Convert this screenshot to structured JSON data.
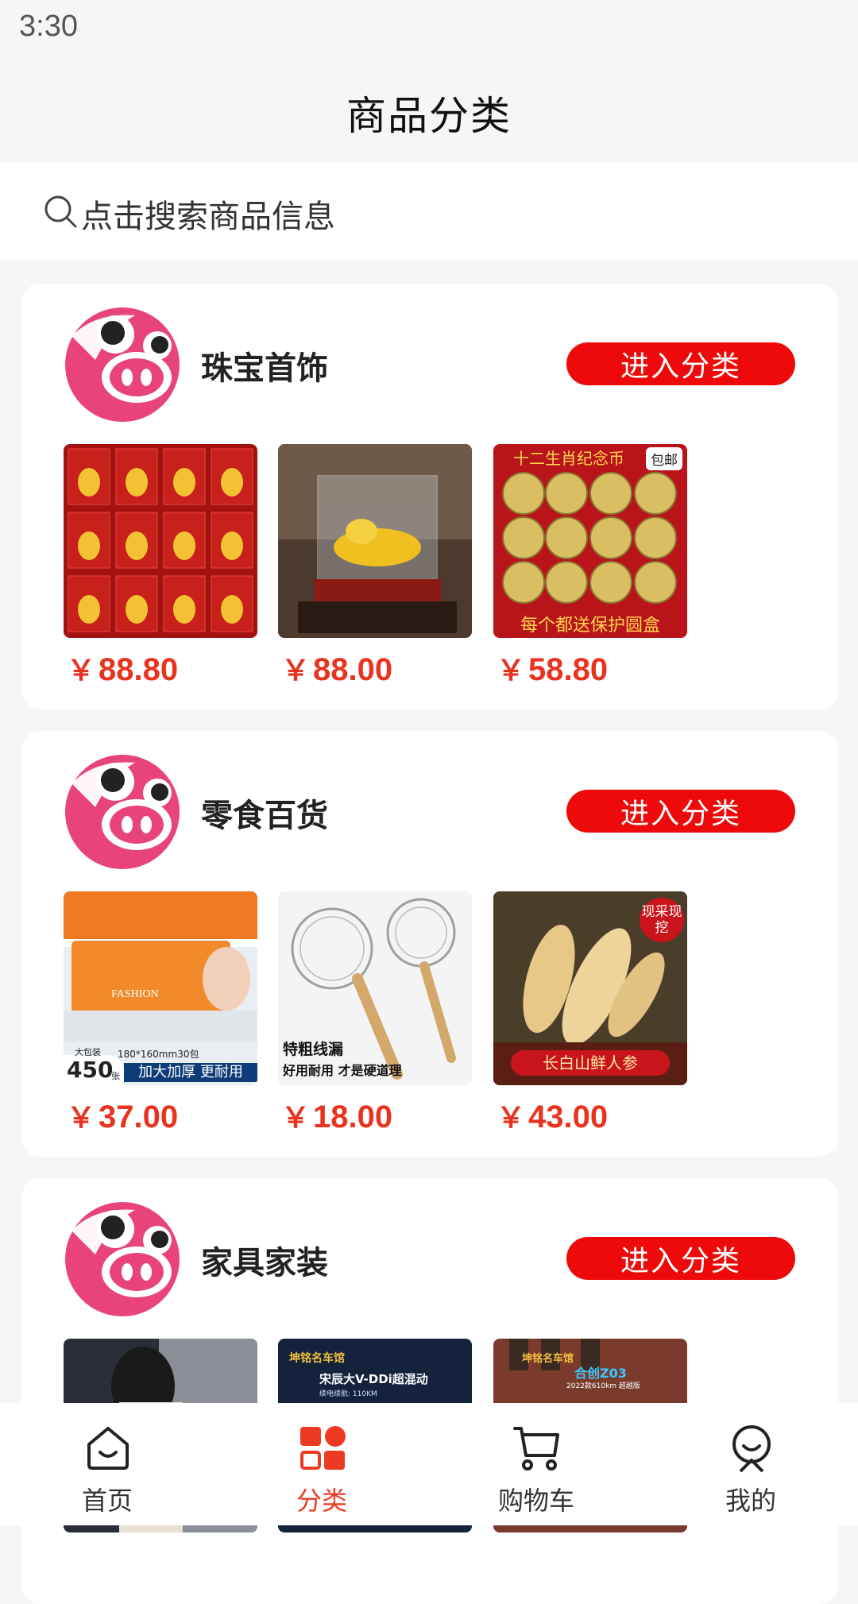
{
  "status_bar": {
    "time": "3:30"
  },
  "header": {
    "title": "商品分类"
  },
  "search": {
    "placeholder": "点击搜索商品信息"
  },
  "colors": {
    "accent": "#ee0a0a",
    "price": "#e8341f",
    "tab_active": "#ee3a23"
  },
  "categories": [
    {
      "name": "珠宝首饰",
      "button": "进入分类",
      "products": [
        {
          "price": "88.80",
          "currency": "￥",
          "image": "golden-zodiac-figurines"
        },
        {
          "price": "88.00",
          "currency": "￥",
          "image": "golden-dragon-display-case"
        },
        {
          "price": "58.80",
          "currency": "￥",
          "image": "zodiac-commemorative-coins",
          "banner": "十二生肖纪念币",
          "tag": "包邮",
          "caption": "每个都送保护圆盒"
        }
      ]
    },
    {
      "name": "零食百货",
      "button": "进入分类",
      "products": [
        {
          "price": "37.00",
          "currency": "￥",
          "image": "tissue-paper-packs",
          "brand": "FASHION",
          "spec": "180*160mm30包",
          "badge_top": "大包装",
          "badge_count": "450",
          "badge_unit": "张",
          "caption": "加大加厚 更耐用"
        },
        {
          "price": "18.00",
          "currency": "￥",
          "image": "wire-mesh-strainers",
          "caption_title": "特粗线漏",
          "caption_sub": "好用耐用 才是硬道理"
        },
        {
          "price": "43.00",
          "currency": "￥",
          "image": "fresh-ginseng-roots",
          "stamp": "现采现挖",
          "caption": "长白山鲜人参"
        }
      ]
    },
    {
      "name": "家具家装",
      "button": "进入分类",
      "products": [
        {
          "image": "person-photo"
        },
        {
          "image": "car-ad",
          "shop": "坤铭名车馆",
          "headline": "宋辰大V-DDi超混动",
          "sub": "续电续航: 110KM"
        },
        {
          "image": "car-ad-2",
          "shop": "坤铭名车馆",
          "headline": "合创Z03",
          "sub": "2022款610km 超越版"
        }
      ]
    }
  ],
  "tabs": [
    {
      "label": "首页",
      "icon": "home-icon"
    },
    {
      "label": "分类",
      "icon": "category-icon",
      "active": true
    },
    {
      "label": "购物车",
      "icon": "cart-icon"
    },
    {
      "label": "我的",
      "icon": "profile-icon"
    }
  ]
}
